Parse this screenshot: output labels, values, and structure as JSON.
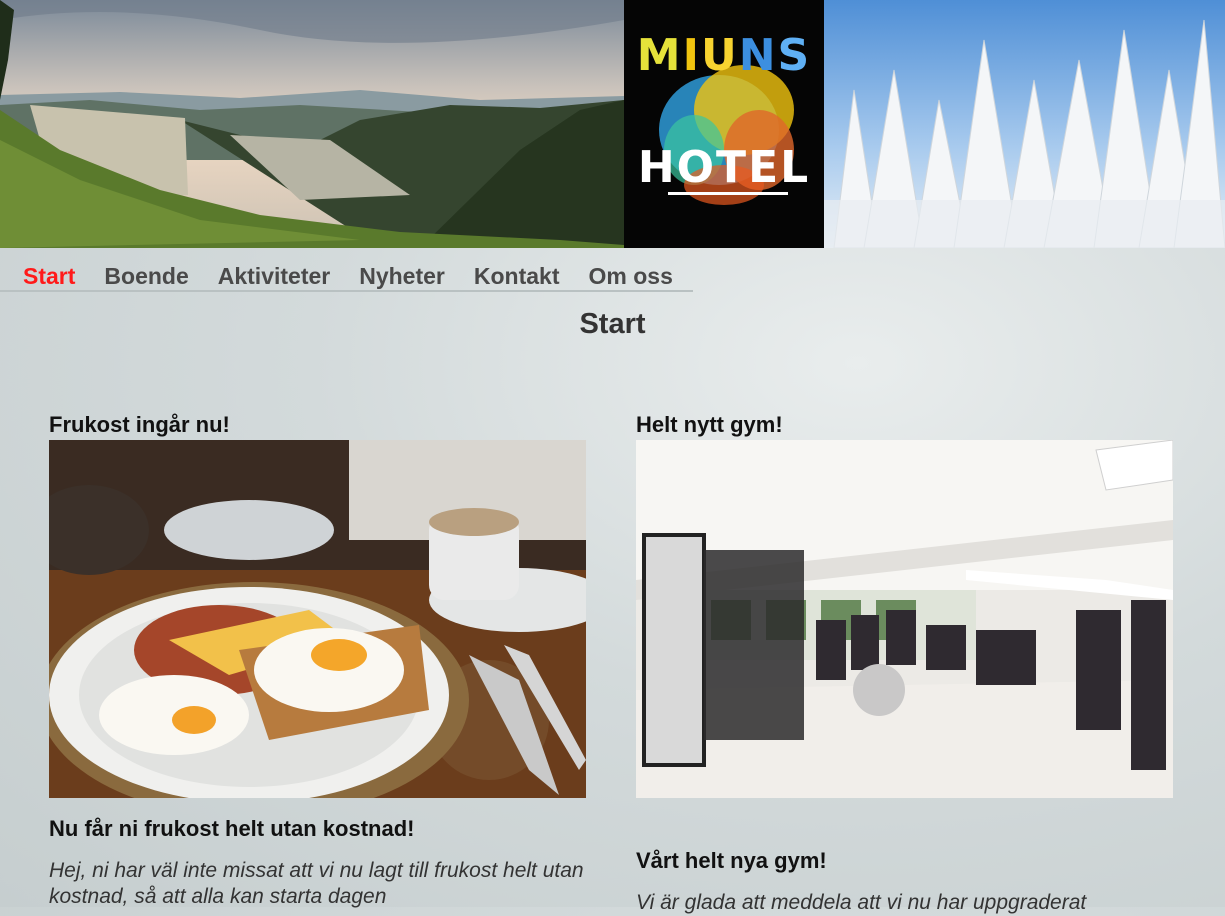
{
  "banner": {
    "logo_top_letters": [
      "M",
      "I",
      "U",
      "N",
      "S"
    ],
    "logo_bottom": "HOTEL",
    "logo_colors": [
      "#e6e23a",
      "#f1c40f",
      "#f7d330",
      "#3c8fe0",
      "#5fb0f5"
    ]
  },
  "nav": {
    "items": [
      {
        "label": "Start",
        "active": true
      },
      {
        "label": "Boende",
        "active": false
      },
      {
        "label": "Aktiviteter",
        "active": false
      },
      {
        "label": "Nyheter",
        "active": false
      },
      {
        "label": "Kontakt",
        "active": false
      },
      {
        "label": "Om oss",
        "active": false
      }
    ],
    "active_color": "#ff1a1a"
  },
  "page": {
    "title": "Start"
  },
  "cards": [
    {
      "heading": "Frukost ingår nu!",
      "image": "breakfast-photo",
      "subheading": "Nu får ni frukost helt utan kostnad!",
      "text": "Hej, ni har väl inte missat att vi nu lagt till frukost helt utan kostnad, så att alla kan starta dagen"
    },
    {
      "heading": "Helt nytt gym!",
      "image": "gym-photo",
      "subheading": "Vårt helt nya gym!",
      "text": "Vi är glada att meddela att vi nu har uppgraderat"
    }
  ]
}
